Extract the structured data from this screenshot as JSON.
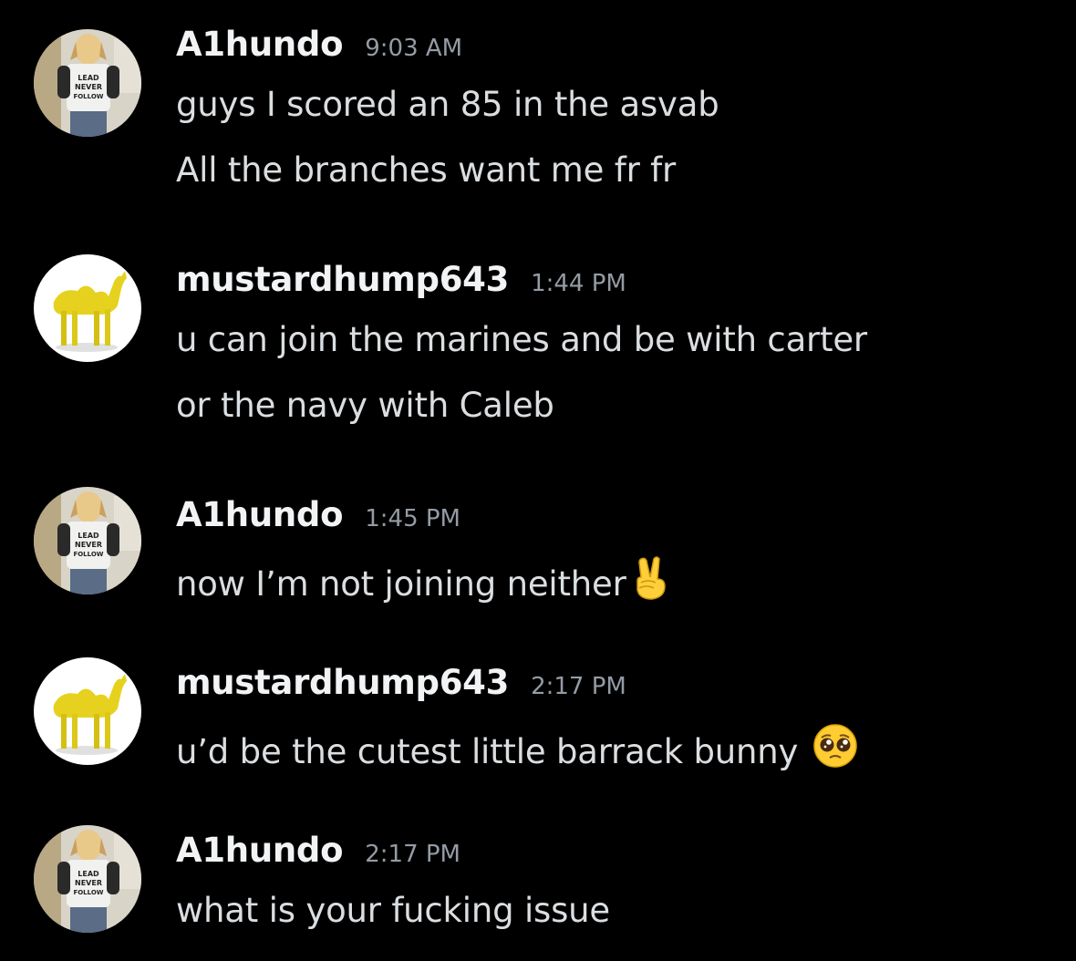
{
  "messages": [
    {
      "username": "A1hundo",
      "time": "9:03 AM",
      "avatar": "dog-shirt-avatar",
      "lines": [
        "guys I scored an 85 in the asvab",
        "All the branches want me fr fr"
      ]
    },
    {
      "username": "mustardhump643",
      "time": "1:44 PM",
      "avatar": "yellow-camel-avatar",
      "lines": [
        "u can join the marines and be with carter",
        "or the navy with Caleb"
      ]
    },
    {
      "username": "A1hundo",
      "time": "1:45 PM",
      "avatar": "dog-shirt-avatar",
      "lines": [
        "now I’m not joining neither"
      ],
      "emoji": "victory-hand-emoji"
    },
    {
      "username": "mustardhump643",
      "time": "2:17 PM",
      "avatar": "yellow-camel-avatar",
      "lines": [
        "u’d be the cutest little barrack bunny "
      ],
      "emoji": "pleading-face-emoji"
    },
    {
      "username": "A1hundo",
      "time": "2:17 PM",
      "avatar": "dog-shirt-avatar",
      "lines": [
        "what is your fucking issue"
      ]
    }
  ],
  "avatar_shirt_text": [
    "LEAD",
    "NEVER",
    "FOLLOW"
  ],
  "colors": {
    "background": "#000000",
    "username": "#f2f3f5",
    "timestamp": "#949ba4",
    "message_text": "#dbdee1"
  }
}
